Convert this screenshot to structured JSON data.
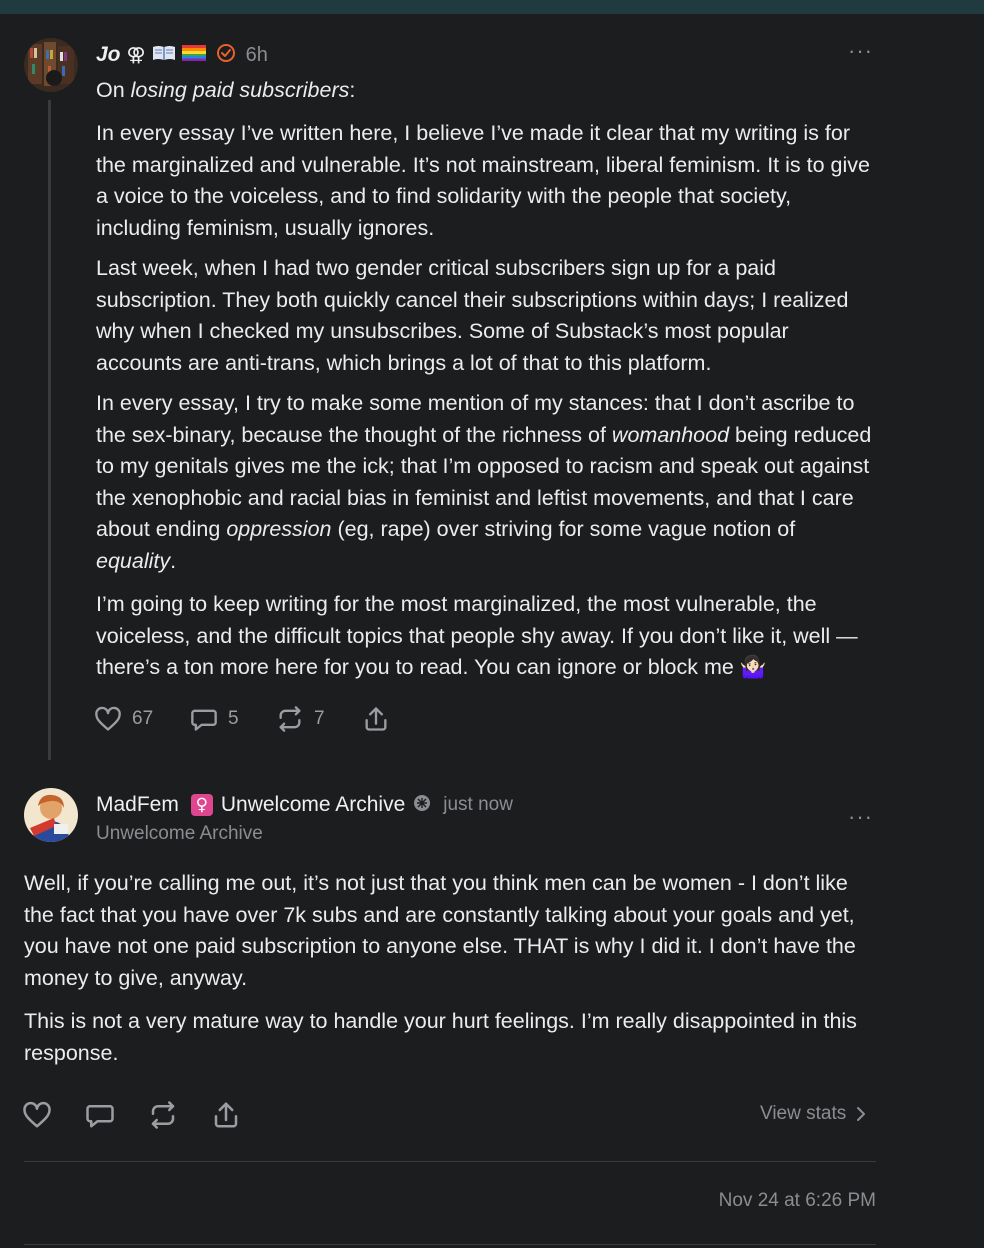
{
  "post1": {
    "author": "Jo",
    "badges": [
      "⚢",
      "📖"
    ],
    "time": "6h",
    "intro_prefix": "On ",
    "intro_italic": "losing paid subscribers",
    "intro_suffix": ":",
    "para1": "In every essay I’ve written here, I believe I’ve made it clear that my writing is for the marginalized and vulnerable. It’s not mainstream, liberal feminism. It is to give a voice to the voiceless, and to find solidarity with the people that society, including feminism, usually ignores.",
    "para2": "Last week, when I had two gender critical subscribers sign up for a paid subscription. They both quickly cancel their subscriptions within days; I realized why when I checked my unsubscribes. Some of Substack’s most popular accounts are anti-trans, which brings a lot of that to this platform.",
    "para3": {
      "a": "In every essay, I try to make some mention of my stances: that I don’t ascribe to the sex-binary, because the thought of the richness of ",
      "b": "womanhood",
      "c": " being reduced to my genitals gives me the ick; that I’m opposed to racism and speak out against the xenophobic and racial bias in feminist and leftist movements, and that I care about ending ",
      "d": "oppression",
      "e": " (eg, rape) over striving for some vague notion of ",
      "f": "equality",
      "g": "."
    },
    "para4": "I’m going to keep writing for the most marginalized, the most vulnerable, the voiceless, and the difficult topics that people shy away. If you don’t like it, well — there’s a ton more here for you to read. You can ignore or block me 🤷🏻‍♀️",
    "likes": "67",
    "comments": "5",
    "restacks": "7",
    "more": "···"
  },
  "post2": {
    "author": "MadFem",
    "emoji": "♀",
    "publication": "Unwelcome Archive",
    "time": "just now",
    "subtitle": "Unwelcome Archive",
    "para1": "Well, if you’re calling me out, it’s not just that you think men can be women - I don’t like the fact that you have over 7k subs and are constantly talking about your goals and yet, you have not one paid subscription to anyone else. THAT is why I did it. I don’t have the money to give, anyway.",
    "para2": "This is not a very mature way to handle your hurt feelings. I’m really disappointed in this response.",
    "view_stats": "View stats",
    "timestamp": "Nov 24 at 6:26 PM",
    "more": "···"
  },
  "colors": {
    "background": "#1c1d1f",
    "top_bar": "#1f3b3f",
    "verified_orange": "#e8622c",
    "emoji_pink": "#e0458f"
  },
  "icons": [
    "heart-icon",
    "comment-icon",
    "restack-icon",
    "share-icon",
    "verified-icon",
    "chevron-right-icon",
    "more-icon"
  ]
}
